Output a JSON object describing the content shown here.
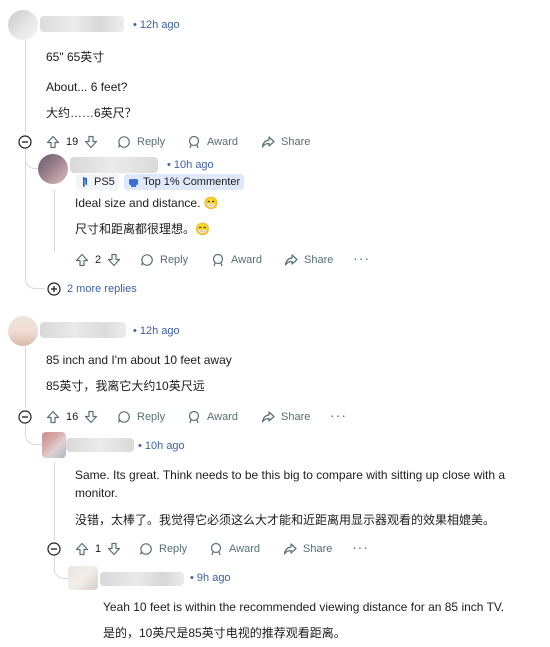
{
  "colors": {
    "link": "#3d5fa8",
    "muted": "#576f76",
    "thread_line": "#d6d9dc",
    "flair_bg": "#dfe9fb"
  },
  "c1": {
    "time": "• 12h ago",
    "lines": [
      "65\"   65英寸",
      "About... 6 feet?",
      "大约……6英尺？"
    ],
    "votes": "19",
    "reply": "Reply",
    "award": "Award",
    "share": "Share"
  },
  "c2": {
    "time": "• 10h ago",
    "flair1": "PS5",
    "flair2": "Top 1% Commenter",
    "lines": [
      "Ideal size and distance. 😁",
      "尺寸和距离都很理想。😁"
    ],
    "votes": "2",
    "reply": "Reply",
    "award": "Award",
    "share": "Share",
    "more_replies": "2 more replies"
  },
  "c3": {
    "time": "• 12h ago",
    "lines": [
      "85 inch and I'm about 10 feet away",
      "85英寸，我离它大约10英尺远"
    ],
    "votes": "16",
    "reply": "Reply",
    "award": "Award",
    "share": "Share"
  },
  "c4": {
    "time": "• 10h ago",
    "lines": [
      "Same. Its great. Think needs to be this big to compare with sitting up close with a",
      "monitor.",
      "没错，太棒了。我觉得它必须这么大才能和近距离用显示器观看的效果相媲美。"
    ],
    "votes": "1",
    "reply": "Reply",
    "award": "Award",
    "share": "Share"
  },
  "c5": {
    "time": "• 9h ago",
    "lines": [
      "Yeah 10 feet is within the recommended viewing distance for an 85 inch TV.",
      "是的，10英尺是85英寸电视的推荐观看距离。"
    ]
  }
}
